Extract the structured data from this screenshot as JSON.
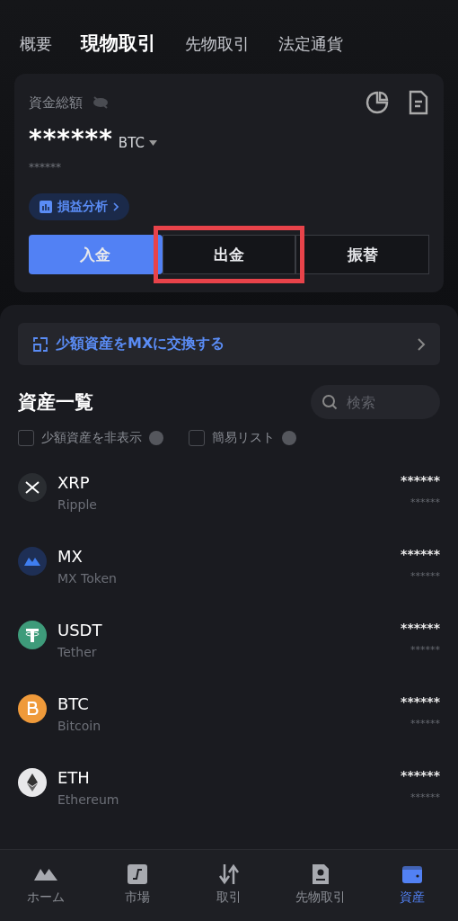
{
  "tabs": [
    {
      "label": "概要",
      "selected": false
    },
    {
      "label": "現物取引",
      "selected": true
    },
    {
      "label": "先物取引",
      "selected": false
    },
    {
      "label": "法定通貨",
      "selected": false
    }
  ],
  "balance": {
    "label": "資金総額",
    "amount": "******",
    "currency": "BTC",
    "sub_amount": "******",
    "pnl_link": "損益分析"
  },
  "actions": [
    {
      "label": "入金",
      "kind": "primary",
      "highlighted": false
    },
    {
      "label": "出金",
      "kind": "outline",
      "highlighted": true
    },
    {
      "label": "振替",
      "kind": "outline",
      "highlighted": false
    }
  ],
  "convert_banner": "少額資産をMXに交換する",
  "assets_title": "資産一覧",
  "search": {
    "placeholder": "検索"
  },
  "filters": [
    {
      "label": "少額資産を非表示",
      "checked": false
    },
    {
      "label": "簡易リスト",
      "checked": false
    }
  ],
  "assets": [
    {
      "symbol": "XRP",
      "name": "Ripple",
      "amount": "******",
      "value": "******",
      "kind": "xrp"
    },
    {
      "symbol": "MX",
      "name": "MX Token",
      "amount": "******",
      "value": "******",
      "kind": "mx"
    },
    {
      "symbol": "USDT",
      "name": "Tether",
      "amount": "******",
      "value": "******",
      "kind": "usdt"
    },
    {
      "symbol": "BTC",
      "name": "Bitcoin",
      "amount": "******",
      "value": "******",
      "kind": "btc"
    },
    {
      "symbol": "ETH",
      "name": "Ethereum",
      "amount": "******",
      "value": "******",
      "kind": "eth"
    }
  ],
  "nav": [
    {
      "label": "ホーム",
      "kind": "home",
      "selected": false
    },
    {
      "label": "市場",
      "kind": "market",
      "selected": false
    },
    {
      "label": "取引",
      "kind": "trade",
      "selected": false
    },
    {
      "label": "先物取引",
      "kind": "futures",
      "selected": false
    },
    {
      "label": "資産",
      "kind": "wallet",
      "selected": true
    }
  ]
}
